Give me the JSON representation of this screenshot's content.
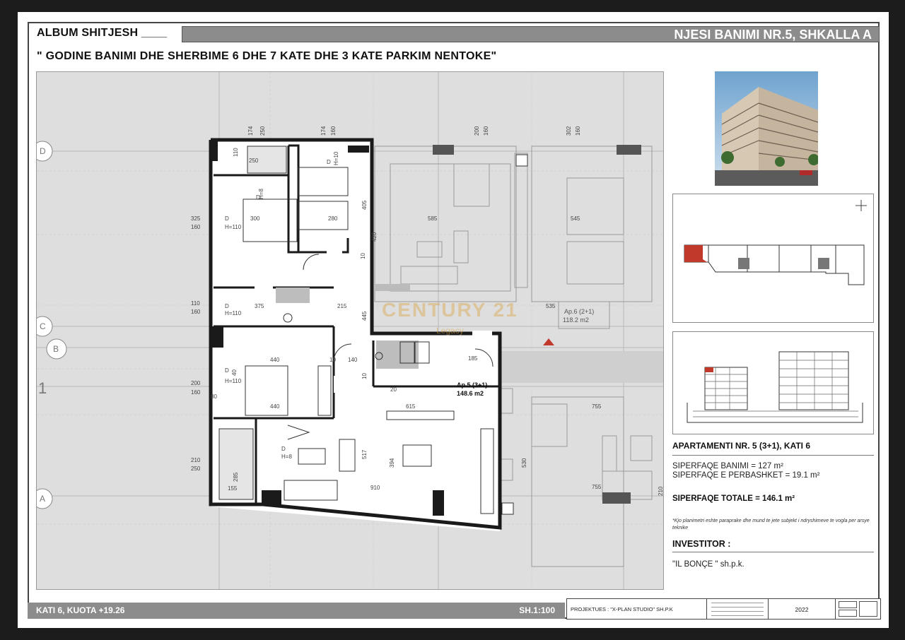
{
  "header": {
    "album_label": "ALBUM SHITJESH ____",
    "unit_title": "NJESI BANIMI NR.5, SHKALLA A",
    "building_subtitle": "\" GODINE BANIMI DHE SHERBIME 6 DHE 7 KATE DHE 3 KATE PARKIM NENTOKE\""
  },
  "plan": {
    "watermark": "CENTURY 21",
    "watermark_sub": "Legacy",
    "axis_labels": [
      "D",
      "C",
      "B",
      "1",
      "A"
    ],
    "apartment_label": "Ap.5 (3+1)",
    "apartment_area": "148.6 m2",
    "neighbor_label": "Ap.6 (2+1)",
    "neighbor_area": "118.2 m2",
    "dims": {
      "d174": "174",
      "d250": "250",
      "d160": "160",
      "d200": "200",
      "d302": "302",
      "d110": "110",
      "d300": "300",
      "d280": "280",
      "d405": "405",
      "d420": "420",
      "d585": "585",
      "d545": "545",
      "d325": "325",
      "d375": "375",
      "d215": "215",
      "d445": "445",
      "d535": "535",
      "d440": "440",
      "d140": "140",
      "d185": "185",
      "d615": "615",
      "d755": "755",
      "d517": "517",
      "d394": "394",
      "d910": "910",
      "d285": "285",
      "d155": "155",
      "d210": "210",
      "d530": "530",
      "d10": "10",
      "d20": "20",
      "d80": "80",
      "d40": "40",
      "dD": "D",
      "h8": "H=8",
      "h110": "H=110",
      "h10": "H=10"
    }
  },
  "sidebar": {
    "apartment_title": "APARTAMENTI NR. 5 (3+1), KATI 6",
    "area_living": "SIPERFAQE BANIMI = 127 m²",
    "area_common": "SIPERFAQE E PERBASHKET = 19.1 m²",
    "area_total": "SIPERFAQE TOTALE = 146.1 m²",
    "note": "*Kjo planimetri eshte paraprake dhe mund te jete subjekt i ndryshimeve te vogla per arsye teknike",
    "investor_title": "INVESTITOR :",
    "investor_name": "\"IL BONÇE \" sh.p.k."
  },
  "footer": {
    "floor_level": "KATI 6, KUOTA +19.26",
    "scale": "SH.1:100",
    "designer": "PROJEKTUES : \"X-PLAN STUDIO\" SH.P.K",
    "year": "2022"
  },
  "colors": {
    "highlight": "#c0392b",
    "bar_gray": "#8c8c8c",
    "wall": "#1a1a1a",
    "watermark": "#d9a64a"
  }
}
